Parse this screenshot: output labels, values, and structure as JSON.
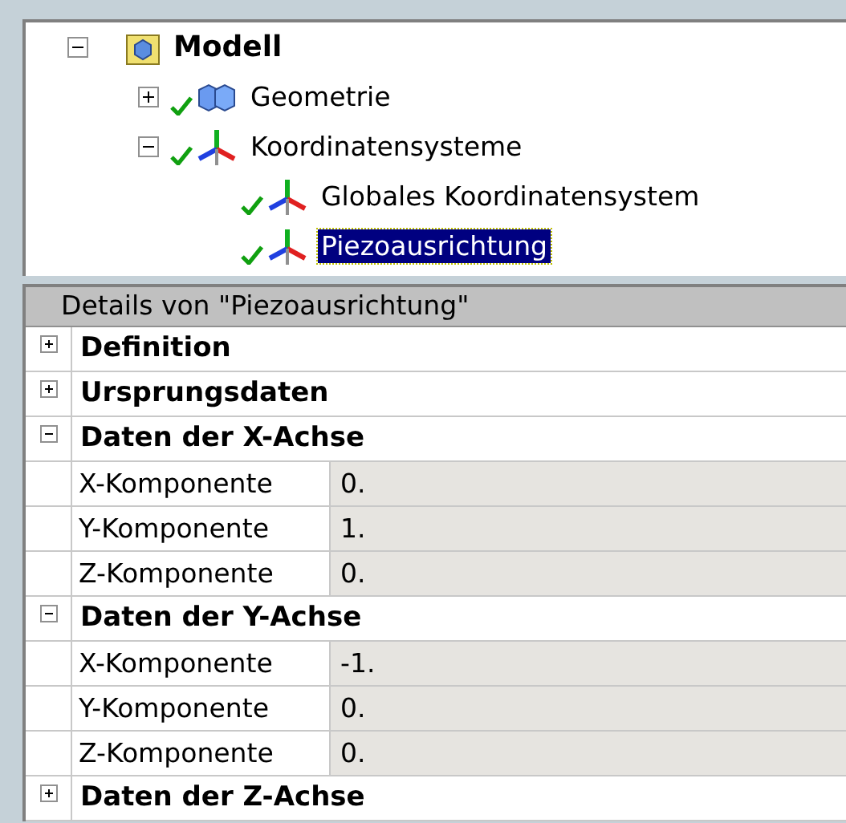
{
  "tree": [
    {
      "label": "Modell",
      "kind": "model",
      "checked": false,
      "expanded": true,
      "selected": false,
      "children": [
        {
          "label": "Geometrie",
          "kind": "geometry",
          "checked": true,
          "expanded": false,
          "selected": false
        },
        {
          "label": "Koordinatensysteme",
          "kind": "axes",
          "checked": true,
          "expanded": true,
          "selected": false,
          "children": [
            {
              "label": "Globales Koordinatensystem",
              "kind": "axes",
              "checked": true,
              "selected": false
            },
            {
              "label": "Piezoausrichtung",
              "kind": "axes",
              "checked": true,
              "selected": true
            }
          ]
        }
      ]
    }
  ],
  "details": {
    "title": "Details von \"Piezoausrichtung\"",
    "groups": [
      {
        "label": "Definition",
        "expanded": false
      },
      {
        "label": "Ursprungsdaten",
        "expanded": false
      },
      {
        "label": "Daten der X-Achse",
        "expanded": true,
        "rows": [
          {
            "name": "X-Komponente",
            "value": "0."
          },
          {
            "name": "Y-Komponente",
            "value": "1."
          },
          {
            "name": "Z-Komponente",
            "value": "0."
          }
        ]
      },
      {
        "label": "Daten der Y-Achse",
        "expanded": true,
        "rows": [
          {
            "name": "X-Komponente",
            "value": "-1."
          },
          {
            "name": "Y-Komponente",
            "value": "0."
          },
          {
            "name": "Z-Komponente",
            "value": "0."
          }
        ]
      },
      {
        "label": "Daten der Z-Achse",
        "expanded": false
      }
    ]
  }
}
